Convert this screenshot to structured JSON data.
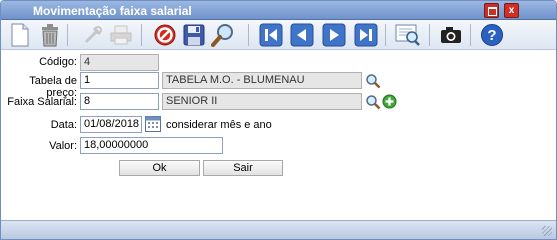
{
  "window": {
    "title": "Movimentação faixa salarial",
    "close_label": "x"
  },
  "toolbar": {
    "buttons": [
      {
        "name": "new-document-icon",
        "enabled": true
      },
      {
        "name": "trash-icon",
        "enabled": true
      },
      {
        "name": "tools-icon",
        "enabled": false
      },
      {
        "name": "printer-icon",
        "enabled": false
      },
      {
        "name": "cancel-icon",
        "enabled": true
      },
      {
        "name": "save-icon",
        "enabled": true
      },
      {
        "name": "search-icon",
        "enabled": true
      },
      {
        "name": "first-record-icon",
        "enabled": true
      },
      {
        "name": "previous-record-icon",
        "enabled": true
      },
      {
        "name": "next-record-icon",
        "enabled": true
      },
      {
        "name": "last-record-icon",
        "enabled": true
      },
      {
        "name": "report-search-icon",
        "enabled": true
      },
      {
        "name": "camera-icon",
        "enabled": true
      },
      {
        "name": "help-icon",
        "enabled": true
      }
    ]
  },
  "form": {
    "codigo": {
      "label": "Código:",
      "value": "4"
    },
    "tabela": {
      "label": "Tabela de preço:",
      "code": "1",
      "description": "TABELA M.O. - BLUMENAU"
    },
    "faixa": {
      "label": "Faixa Salarial:",
      "code": "8",
      "description": "SENIOR II"
    },
    "data": {
      "label": "Data:",
      "value": "01/08/2018",
      "note": "considerar mês e ano"
    },
    "valor": {
      "label": "Valor:",
      "value": "18,00000000"
    },
    "ok_label": "Ok",
    "sair_label": "Sair"
  },
  "colors": {
    "titlebar": "#7b9dd2",
    "close": "#d02f27",
    "accent": "#1a56b8"
  }
}
